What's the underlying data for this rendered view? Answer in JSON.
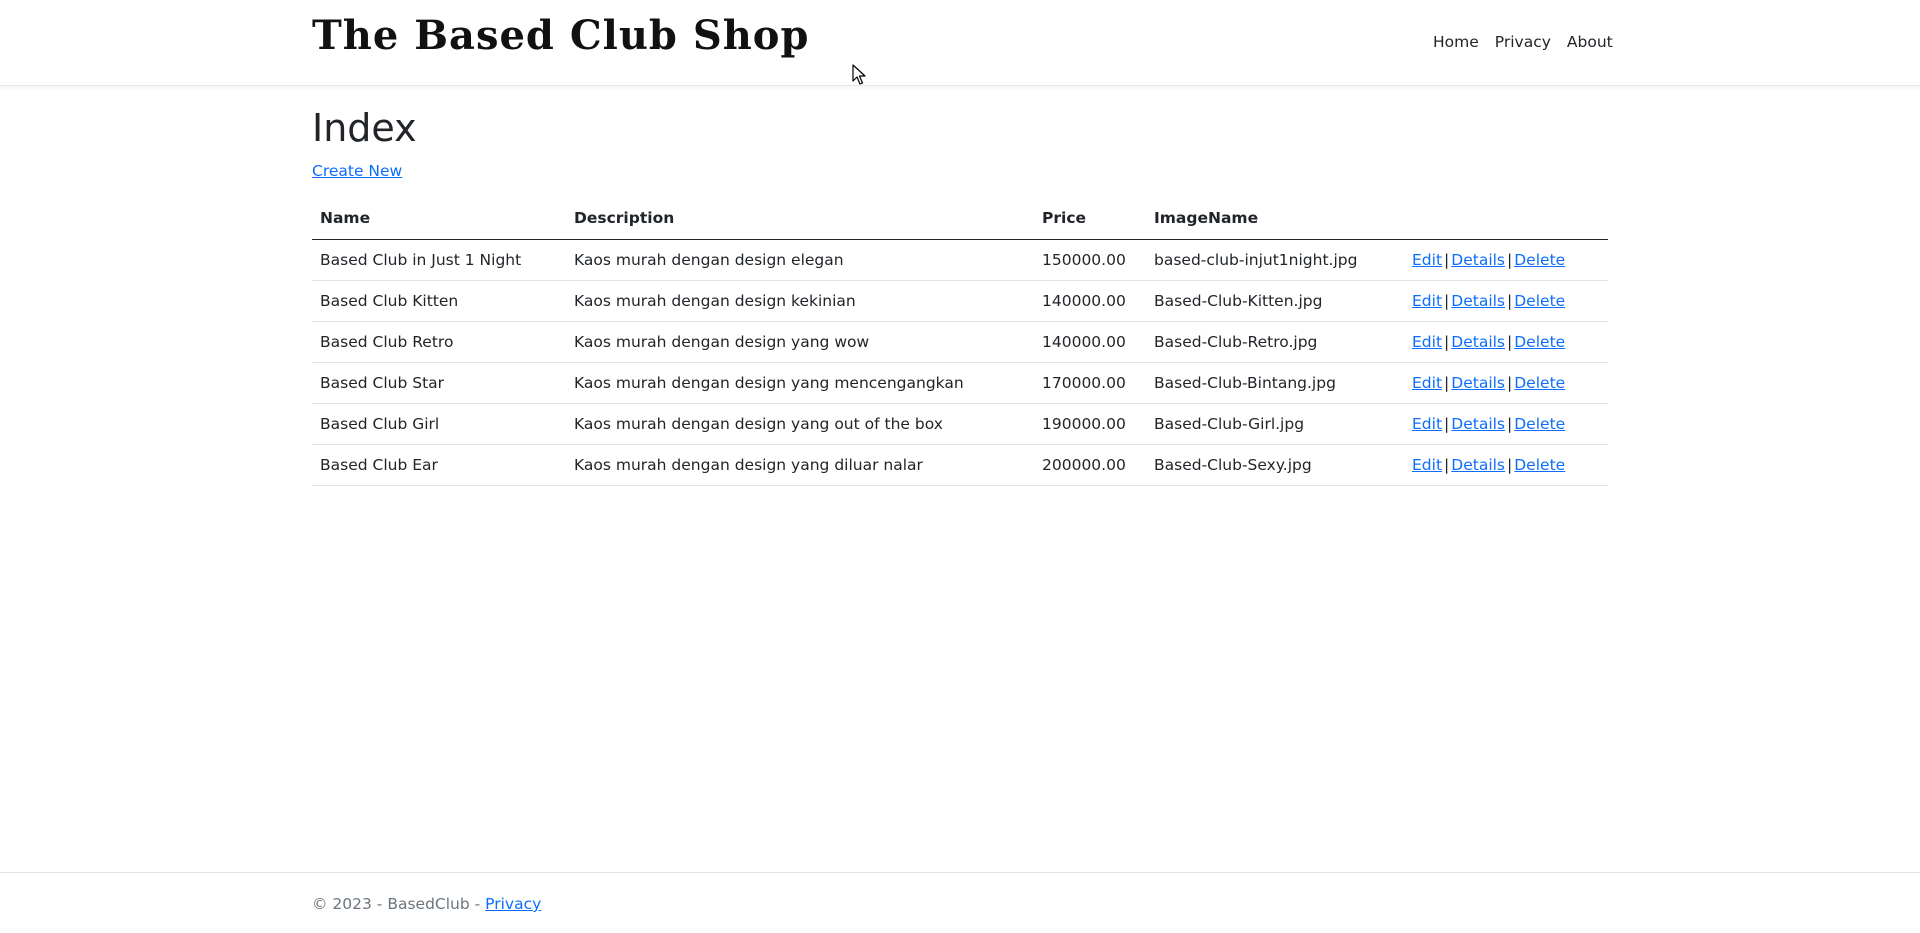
{
  "header": {
    "brand": "The Based Club Shop",
    "nav": [
      {
        "label": "Home"
      },
      {
        "label": "Privacy"
      },
      {
        "label": "About"
      }
    ]
  },
  "main": {
    "title": "Index",
    "create_link": "Create New",
    "table": {
      "columns": [
        "Name",
        "Description",
        "Price",
        "ImageName"
      ],
      "rows": [
        {
          "name": "Based Club in Just 1 Night",
          "description": "Kaos murah dengan design elegan",
          "price": "150000.00",
          "image": "based-club-injut1night.jpg"
        },
        {
          "name": "Based Club Kitten",
          "description": "Kaos murah dengan design kekinian",
          "price": "140000.00",
          "image": "Based-Club-Kitten.jpg"
        },
        {
          "name": "Based Club Retro",
          "description": "Kaos murah dengan design yang wow",
          "price": "140000.00",
          "image": "Based-Club-Retro.jpg"
        },
        {
          "name": "Based Club Star",
          "description": "Kaos murah dengan design yang mencengangkan",
          "price": "170000.00",
          "image": "Based-Club-Bintang.jpg"
        },
        {
          "name": "Based Club Girl",
          "description": "Kaos murah dengan design yang out of the box",
          "price": "190000.00",
          "image": "Based-Club-Girl.jpg"
        },
        {
          "name": "Based Club Ear",
          "description": "Kaos murah dengan design yang diluar nalar",
          "price": "200000.00",
          "image": "Based-Club-Sexy.jpg"
        }
      ],
      "actions": {
        "edit": "Edit",
        "details": "Details",
        "delete": "Delete",
        "separator": "|"
      }
    }
  },
  "footer": {
    "text": "© 2023 - BasedClub - ",
    "privacy_link": "Privacy"
  },
  "colors": {
    "link": "#0d6efd",
    "text": "#212529",
    "muted": "#6c757d"
  }
}
